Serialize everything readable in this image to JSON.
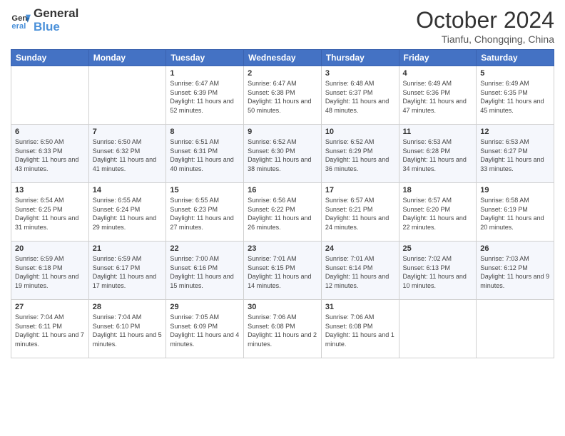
{
  "logo": {
    "line1": "General",
    "line2": "Blue"
  },
  "title": "October 2024",
  "location": "Tianfu, Chongqing, China",
  "days_of_week": [
    "Sunday",
    "Monday",
    "Tuesday",
    "Wednesday",
    "Thursday",
    "Friday",
    "Saturday"
  ],
  "weeks": [
    [
      {
        "day": "",
        "content": ""
      },
      {
        "day": "",
        "content": ""
      },
      {
        "day": "1",
        "content": "Sunrise: 6:47 AM\nSunset: 6:39 PM\nDaylight: 11 hours and 52 minutes."
      },
      {
        "day": "2",
        "content": "Sunrise: 6:47 AM\nSunset: 6:38 PM\nDaylight: 11 hours and 50 minutes."
      },
      {
        "day": "3",
        "content": "Sunrise: 6:48 AM\nSunset: 6:37 PM\nDaylight: 11 hours and 48 minutes."
      },
      {
        "day": "4",
        "content": "Sunrise: 6:49 AM\nSunset: 6:36 PM\nDaylight: 11 hours and 47 minutes."
      },
      {
        "day": "5",
        "content": "Sunrise: 6:49 AM\nSunset: 6:35 PM\nDaylight: 11 hours and 45 minutes."
      }
    ],
    [
      {
        "day": "6",
        "content": "Sunrise: 6:50 AM\nSunset: 6:33 PM\nDaylight: 11 hours and 43 minutes."
      },
      {
        "day": "7",
        "content": "Sunrise: 6:50 AM\nSunset: 6:32 PM\nDaylight: 11 hours and 41 minutes."
      },
      {
        "day": "8",
        "content": "Sunrise: 6:51 AM\nSunset: 6:31 PM\nDaylight: 11 hours and 40 minutes."
      },
      {
        "day": "9",
        "content": "Sunrise: 6:52 AM\nSunset: 6:30 PM\nDaylight: 11 hours and 38 minutes."
      },
      {
        "day": "10",
        "content": "Sunrise: 6:52 AM\nSunset: 6:29 PM\nDaylight: 11 hours and 36 minutes."
      },
      {
        "day": "11",
        "content": "Sunrise: 6:53 AM\nSunset: 6:28 PM\nDaylight: 11 hours and 34 minutes."
      },
      {
        "day": "12",
        "content": "Sunrise: 6:53 AM\nSunset: 6:27 PM\nDaylight: 11 hours and 33 minutes."
      }
    ],
    [
      {
        "day": "13",
        "content": "Sunrise: 6:54 AM\nSunset: 6:25 PM\nDaylight: 11 hours and 31 minutes."
      },
      {
        "day": "14",
        "content": "Sunrise: 6:55 AM\nSunset: 6:24 PM\nDaylight: 11 hours and 29 minutes."
      },
      {
        "day": "15",
        "content": "Sunrise: 6:55 AM\nSunset: 6:23 PM\nDaylight: 11 hours and 27 minutes."
      },
      {
        "day": "16",
        "content": "Sunrise: 6:56 AM\nSunset: 6:22 PM\nDaylight: 11 hours and 26 minutes."
      },
      {
        "day": "17",
        "content": "Sunrise: 6:57 AM\nSunset: 6:21 PM\nDaylight: 11 hours and 24 minutes."
      },
      {
        "day": "18",
        "content": "Sunrise: 6:57 AM\nSunset: 6:20 PM\nDaylight: 11 hours and 22 minutes."
      },
      {
        "day": "19",
        "content": "Sunrise: 6:58 AM\nSunset: 6:19 PM\nDaylight: 11 hours and 20 minutes."
      }
    ],
    [
      {
        "day": "20",
        "content": "Sunrise: 6:59 AM\nSunset: 6:18 PM\nDaylight: 11 hours and 19 minutes."
      },
      {
        "day": "21",
        "content": "Sunrise: 6:59 AM\nSunset: 6:17 PM\nDaylight: 11 hours and 17 minutes."
      },
      {
        "day": "22",
        "content": "Sunrise: 7:00 AM\nSunset: 6:16 PM\nDaylight: 11 hours and 15 minutes."
      },
      {
        "day": "23",
        "content": "Sunrise: 7:01 AM\nSunset: 6:15 PM\nDaylight: 11 hours and 14 minutes."
      },
      {
        "day": "24",
        "content": "Sunrise: 7:01 AM\nSunset: 6:14 PM\nDaylight: 11 hours and 12 minutes."
      },
      {
        "day": "25",
        "content": "Sunrise: 7:02 AM\nSunset: 6:13 PM\nDaylight: 11 hours and 10 minutes."
      },
      {
        "day": "26",
        "content": "Sunrise: 7:03 AM\nSunset: 6:12 PM\nDaylight: 11 hours and 9 minutes."
      }
    ],
    [
      {
        "day": "27",
        "content": "Sunrise: 7:04 AM\nSunset: 6:11 PM\nDaylight: 11 hours and 7 minutes."
      },
      {
        "day": "28",
        "content": "Sunrise: 7:04 AM\nSunset: 6:10 PM\nDaylight: 11 hours and 5 minutes."
      },
      {
        "day": "29",
        "content": "Sunrise: 7:05 AM\nSunset: 6:09 PM\nDaylight: 11 hours and 4 minutes."
      },
      {
        "day": "30",
        "content": "Sunrise: 7:06 AM\nSunset: 6:08 PM\nDaylight: 11 hours and 2 minutes."
      },
      {
        "day": "31",
        "content": "Sunrise: 7:06 AM\nSunset: 6:08 PM\nDaylight: 11 hours and 1 minute."
      },
      {
        "day": "",
        "content": ""
      },
      {
        "day": "",
        "content": ""
      }
    ]
  ]
}
